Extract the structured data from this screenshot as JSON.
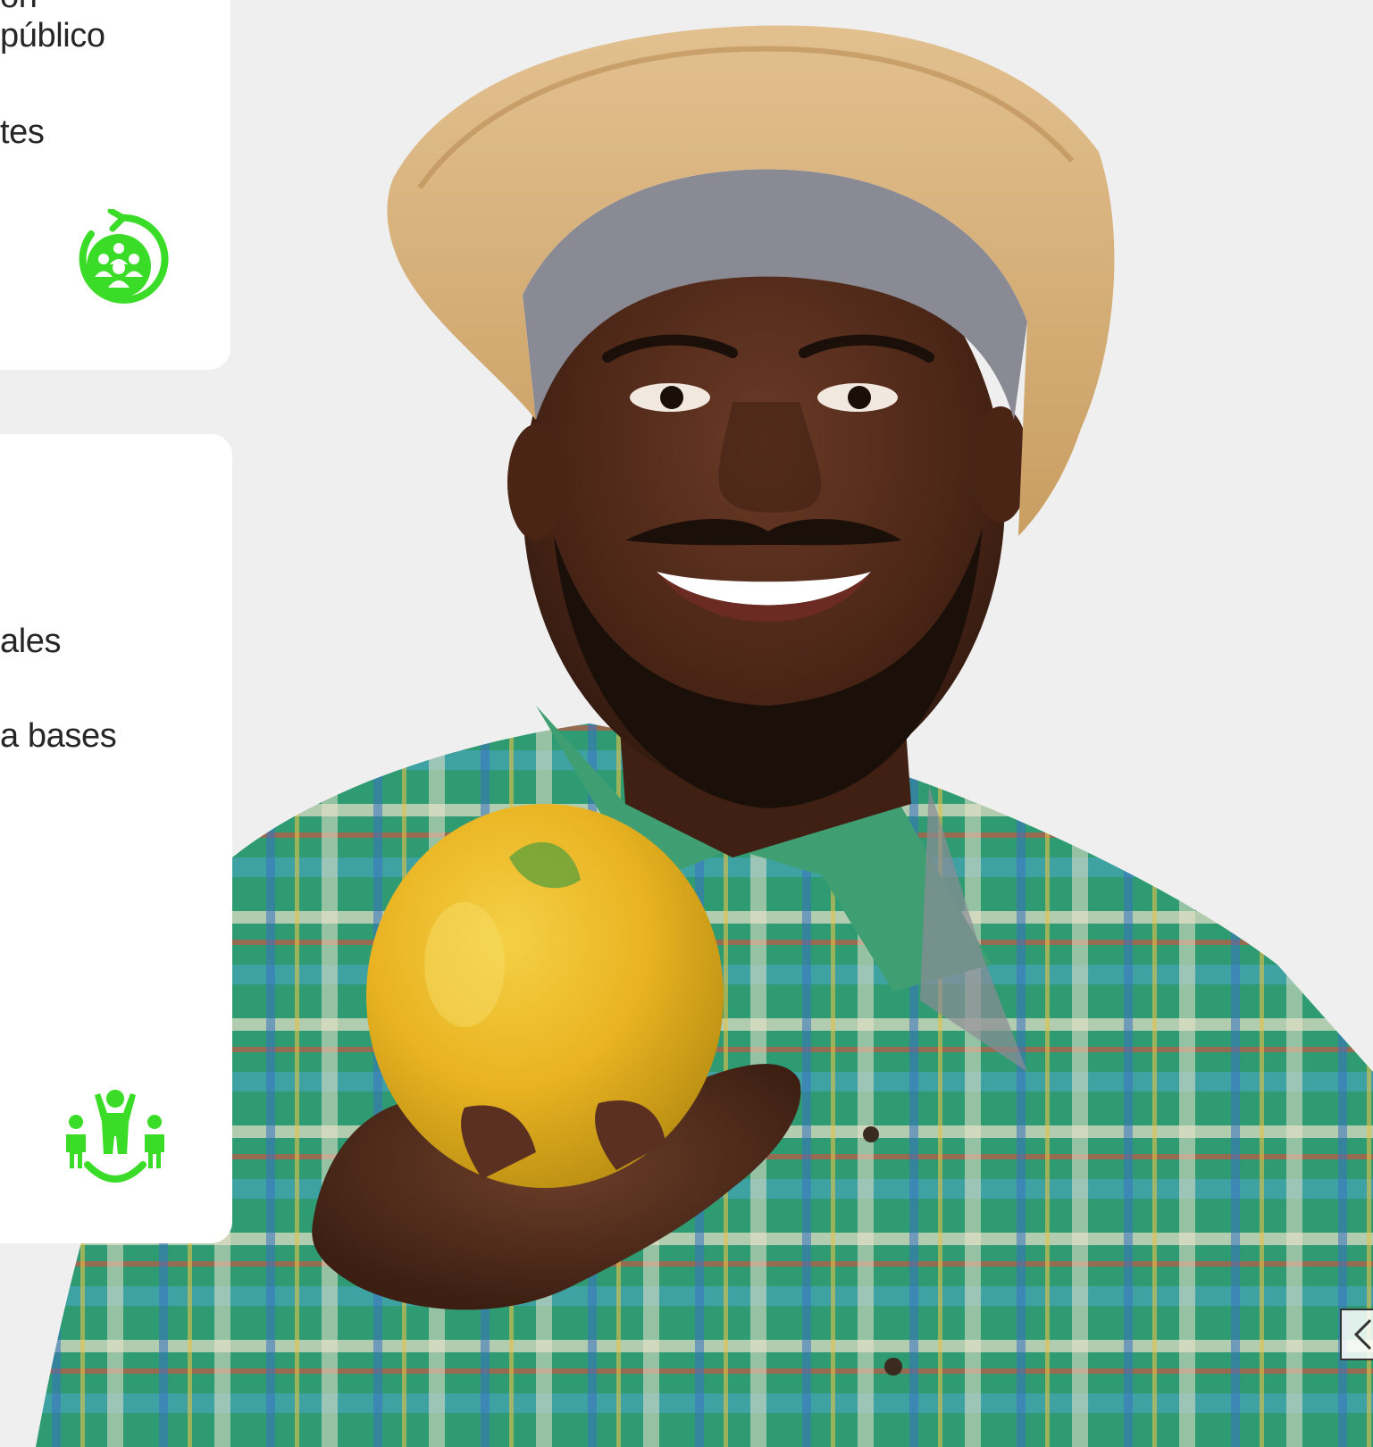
{
  "cards": [
    {
      "lines": [
        "ón",
        "público",
        "",
        "tes"
      ],
      "icon": "community-cycle-icon"
    },
    {
      "lines": [
        "ales",
        "",
        "a bases"
      ],
      "icon": "group-support-icon"
    }
  ],
  "carousel": {
    "prev_icon": "chevron-left-icon"
  },
  "colors": {
    "accent": "#3bdc28",
    "card_bg": "#ffffff",
    "page_bg": "#efefef",
    "text": "#262626"
  }
}
